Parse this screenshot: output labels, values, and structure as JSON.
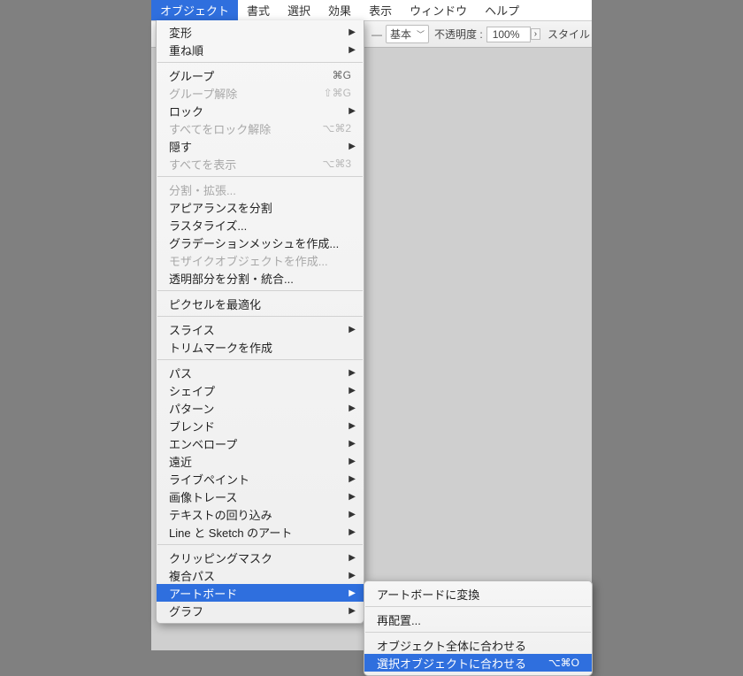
{
  "menubar": {
    "items": [
      "オブジェクト",
      "書式",
      "選択",
      "効果",
      "表示",
      "ウィンドウ",
      "ヘルプ"
    ]
  },
  "toolbar": {
    "select_label": "基本",
    "opacity_label": "不透明度 :",
    "opacity_value": "100%",
    "style_label": "スタイル"
  },
  "menu": {
    "g0": [
      {
        "label": "変形",
        "sub": true
      },
      {
        "label": "重ね順",
        "sub": true
      }
    ],
    "g1": [
      {
        "label": "グループ",
        "shortcut": "⌘G"
      },
      {
        "label": "グループ解除",
        "shortcut": "⇧⌘G",
        "disabled": true
      },
      {
        "label": "ロック",
        "sub": true
      },
      {
        "label": "すべてをロック解除",
        "shortcut": "⌥⌘2",
        "disabled": true
      },
      {
        "label": "隠す",
        "sub": true
      },
      {
        "label": "すべてを表示",
        "shortcut": "⌥⌘3",
        "disabled": true
      }
    ],
    "g2": [
      {
        "label": "分割・拡張...",
        "disabled": true
      },
      {
        "label": "アピアランスを分割"
      },
      {
        "label": "ラスタライズ..."
      },
      {
        "label": "グラデーションメッシュを作成..."
      },
      {
        "label": "モザイクオブジェクトを作成...",
        "disabled": true
      },
      {
        "label": "透明部分を分割・統合..."
      }
    ],
    "g3": [
      {
        "label": "ピクセルを最適化"
      }
    ],
    "g4": [
      {
        "label": "スライス",
        "sub": true
      },
      {
        "label": "トリムマークを作成"
      }
    ],
    "g5": [
      {
        "label": "パス",
        "sub": true
      },
      {
        "label": "シェイプ",
        "sub": true
      },
      {
        "label": "パターン",
        "sub": true
      },
      {
        "label": "ブレンド",
        "sub": true
      },
      {
        "label": "エンベロープ",
        "sub": true
      },
      {
        "label": "遠近",
        "sub": true
      },
      {
        "label": "ライブペイント",
        "sub": true
      },
      {
        "label": "画像トレース",
        "sub": true
      },
      {
        "label": "テキストの回り込み",
        "sub": true
      },
      {
        "label": "Line と Sketch のアート",
        "sub": true
      }
    ],
    "g6": [
      {
        "label": "クリッピングマスク",
        "sub": true
      },
      {
        "label": "複合パス",
        "sub": true
      },
      {
        "label": "アートボード",
        "sub": true,
        "highlight": true
      },
      {
        "label": "グラフ",
        "sub": true
      }
    ]
  },
  "submenu": {
    "g0": [
      {
        "label": "アートボードに変換"
      }
    ],
    "g1": [
      {
        "label": "再配置..."
      }
    ],
    "g2": [
      {
        "label": "オブジェクト全体に合わせる"
      },
      {
        "label": "選択オブジェクトに合わせる",
        "shortcut": "⌥⌘O",
        "highlight": true
      }
    ]
  }
}
